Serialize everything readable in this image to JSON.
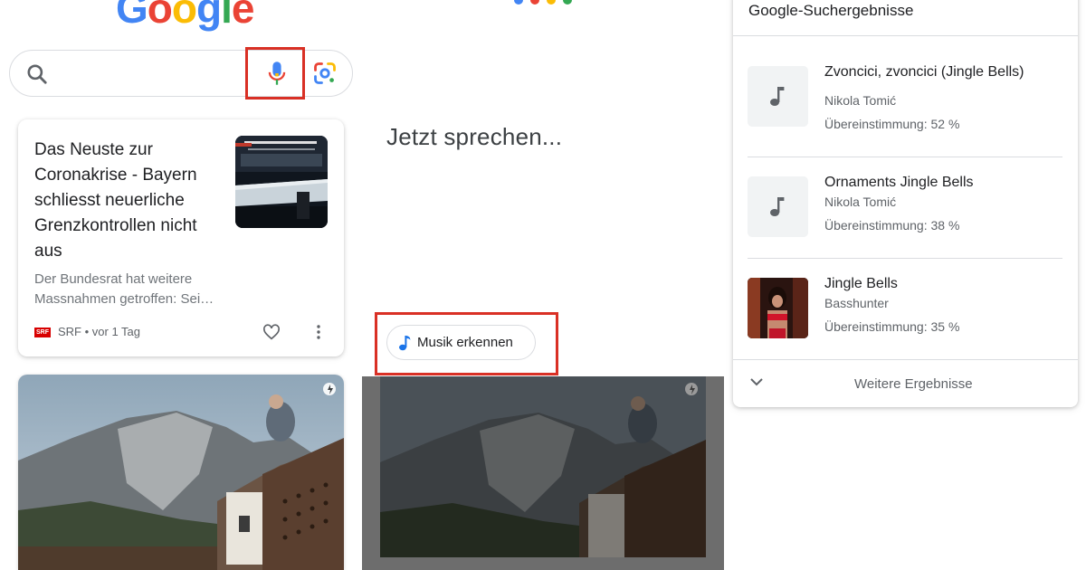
{
  "panel1": {
    "logo_letters": [
      {
        "char": "G",
        "color": "#4285F4"
      },
      {
        "char": "o",
        "color": "#EA4335"
      },
      {
        "char": "o",
        "color": "#FBBC05"
      },
      {
        "char": "g",
        "color": "#4285F4"
      },
      {
        "char": "l",
        "color": "#34A853"
      },
      {
        "char": "e",
        "color": "#EA4335"
      }
    ],
    "search": {
      "value": "",
      "placeholder": ""
    },
    "highlight_color": "#D93025",
    "news_card": {
      "title": "Das Neuste zur Coronakrise - Bayern schliesst neuerliche Grenzkontrollen nicht aus",
      "snippet_line1": "Der Bundesrat hat weitere",
      "snippet_line2": "Massnahmen getroffen: Sei…",
      "source_logo": "SRF",
      "source": "SRF • vor 1 Tag"
    }
  },
  "panel2": {
    "dot_colors": [
      "#4285F4",
      "#EA4335",
      "#FBBC05",
      "#34A853"
    ],
    "prompt": "Jetzt sprechen...",
    "music_chip_label": "Musik erkennen"
  },
  "panel3": {
    "title": "Google-Suchergebnisse",
    "results": [
      {
        "title": "Zvoncici, zvoncici (Jingle Bells)",
        "artist": "Nikola Tomić",
        "match": "Übereinstimmung: 52 %"
      },
      {
        "title": "Ornaments Jingle Bells",
        "artist": "Nikola Tomić",
        "match": "Übereinstimmung: 38 %"
      },
      {
        "title": "Jingle Bells",
        "artist": "Basshunter",
        "match": "Übereinstimmung: 35 %"
      }
    ],
    "more_label": "Weitere Ergebnisse"
  }
}
